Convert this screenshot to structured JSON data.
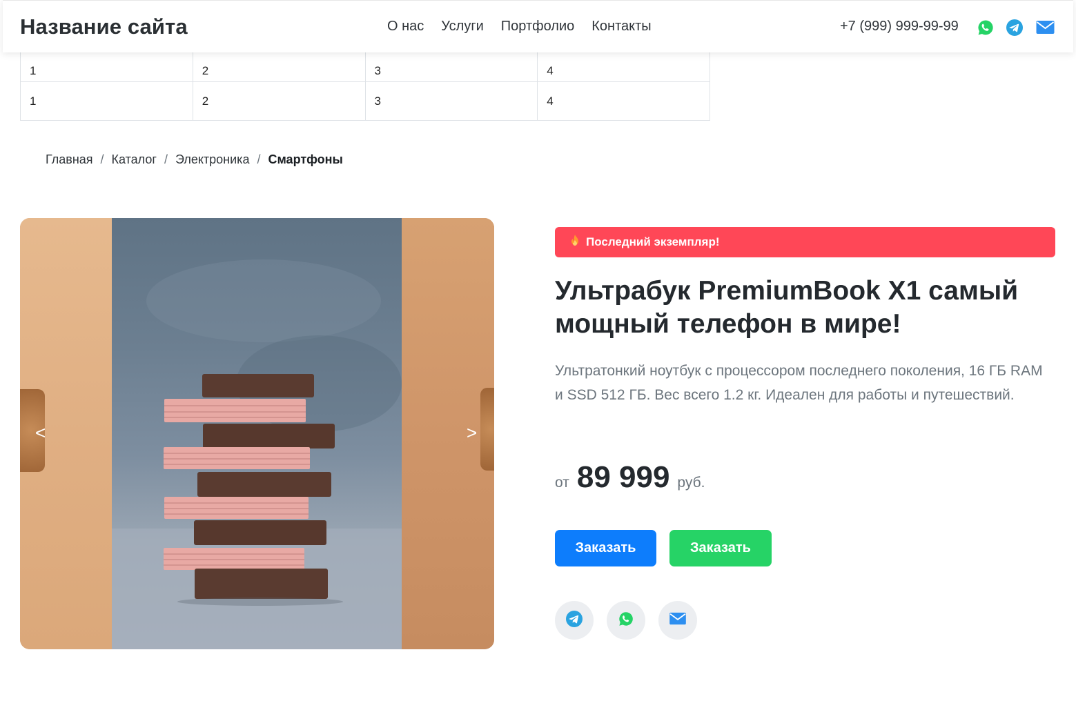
{
  "header": {
    "site_name": "Название сайта",
    "nav": [
      "О нас",
      "Услуги",
      "Портфолио",
      "Контакты"
    ],
    "phone": "+7 (999) 999-99-99",
    "icons": [
      "whatsapp-icon",
      "telegram-icon",
      "mail-icon"
    ]
  },
  "table": {
    "rows": [
      [
        "1",
        "2",
        "3",
        "4"
      ],
      [
        "1",
        "2",
        "3",
        "4"
      ]
    ]
  },
  "breadcrumb": {
    "items": [
      "Главная",
      "Каталог",
      "Электроника"
    ],
    "separator": "/",
    "current": "Смартфоны"
  },
  "gallery": {
    "prev": "<",
    "next": ">"
  },
  "product": {
    "badge": "Последний экземпляр!",
    "title": "Ультрабук PremiumBook X1 самый мощный телефон в мире!",
    "description": "Ультратонкий ноутбук с процессором последнего поколения, 16 ГБ RAM и SSD 512 ГБ. Вес всего 1.2 кг. Идеален для работы и путешествий.",
    "price_prefix": "от",
    "price": "89 999",
    "currency": "руб.",
    "order_button_1": "Заказать",
    "order_button_2": "Заказать"
  },
  "colors": {
    "badge": "#ff4757",
    "primary_button": "#0d7dfc",
    "secondary_button": "#26d366",
    "whatsapp": "#25d366",
    "telegram": "#2aa3e0",
    "mail": "#2d8ff0"
  }
}
